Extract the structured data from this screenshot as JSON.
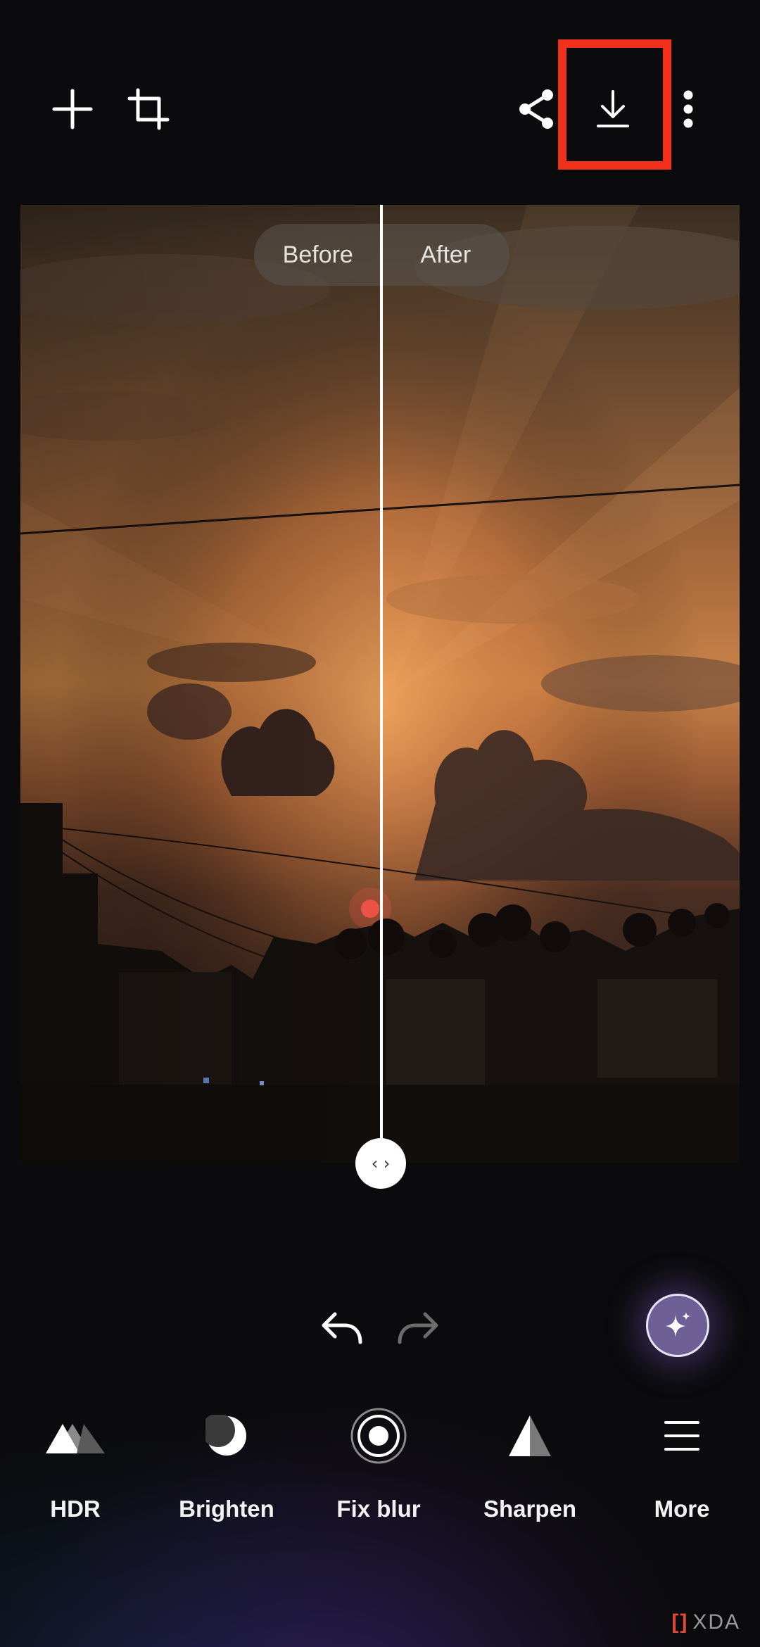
{
  "toolbar": {
    "add_icon": "plus-icon",
    "crop_icon": "crop-icon",
    "share_icon": "share-icon",
    "download_icon": "download-icon",
    "more_icon": "more-vertical-icon",
    "highlight_color": "#f0301a"
  },
  "compare": {
    "before_label": "Before",
    "after_label": "After",
    "handle_glyph": "‹ ›"
  },
  "actions": {
    "undo_icon": "undo-icon",
    "redo_icon": "redo-icon",
    "ai_icon": "sparkle-icon"
  },
  "tools": [
    {
      "label": "HDR",
      "icon": "mountains-icon"
    },
    {
      "label": "Brighten",
      "icon": "moon-icon"
    },
    {
      "label": "Fix blur",
      "icon": "target-icon"
    },
    {
      "label": "Sharpen",
      "icon": "triangle-icon"
    },
    {
      "label": "More",
      "icon": "menu-icon"
    }
  ],
  "watermark": {
    "mark": "[]",
    "text": "XDA"
  }
}
